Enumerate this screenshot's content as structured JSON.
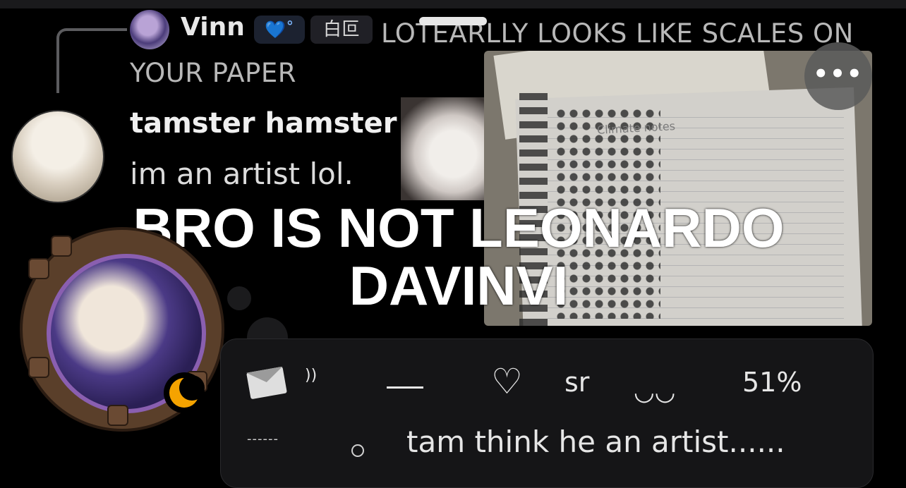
{
  "reply": {
    "author": "Vinn",
    "badge_icon": "heart-gem-icon",
    "tag": "白叵",
    "text": "LOTEARLLY LOOKS LIKE SCALES ON YOUR PAPER"
  },
  "message": {
    "author": "tamster hamster",
    "text": "im an artist lol."
  },
  "meme_caption": "BRO IS NOT LEONARDO DAVINVI",
  "photo": {
    "label": "Climate notes"
  },
  "status": {
    "envelope": "envelope-icon",
    "sound_marks": "))",
    "heart": "♡",
    "sr": "sr",
    "smile": "◡◡",
    "percent": "51%",
    "dashes": "------",
    "note": "tam think he an artist......"
  },
  "more_label": "•••",
  "colors": {
    "background": "#000000",
    "card": "#151517",
    "moon": "#f5a300",
    "badge": "#7fb8ff"
  }
}
